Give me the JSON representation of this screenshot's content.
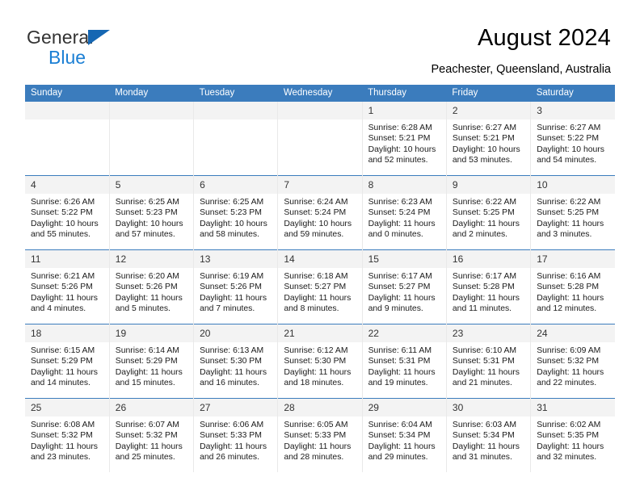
{
  "brand": {
    "name_top": "General",
    "name_bottom": "Blue",
    "accent_color": "#1567b3",
    "accent_color_text": "#1b7fd4"
  },
  "header": {
    "title": "August 2024",
    "subtitle": "Peachester, Queensland, Australia"
  },
  "theme": {
    "header_row_bg": "#3b7cbd",
    "header_row_text": "#ffffff",
    "daynum_bg": "#f3f3f3",
    "cell_bg": "#ffffff"
  },
  "weekday_headers": [
    "Sunday",
    "Monday",
    "Tuesday",
    "Wednesday",
    "Thursday",
    "Friday",
    "Saturday"
  ],
  "labels": {
    "sunrise_prefix": "Sunrise:",
    "sunset_prefix": "Sunset:",
    "daylight_prefix": "Daylight:"
  },
  "weeks": [
    [
      {
        "day": "",
        "empty": true
      },
      {
        "day": "",
        "empty": true
      },
      {
        "day": "",
        "empty": true
      },
      {
        "day": "",
        "empty": true
      },
      {
        "day": "1",
        "sunrise": "Sunrise: 6:28 AM",
        "sunset": "Sunset: 5:21 PM",
        "daylight_1": "Daylight: 10 hours",
        "daylight_2": "and 52 minutes."
      },
      {
        "day": "2",
        "sunrise": "Sunrise: 6:27 AM",
        "sunset": "Sunset: 5:21 PM",
        "daylight_1": "Daylight: 10 hours",
        "daylight_2": "and 53 minutes."
      },
      {
        "day": "3",
        "sunrise": "Sunrise: 6:27 AM",
        "sunset": "Sunset: 5:22 PM",
        "daylight_1": "Daylight: 10 hours",
        "daylight_2": "and 54 minutes."
      }
    ],
    [
      {
        "day": "4",
        "sunrise": "Sunrise: 6:26 AM",
        "sunset": "Sunset: 5:22 PM",
        "daylight_1": "Daylight: 10 hours",
        "daylight_2": "and 55 minutes."
      },
      {
        "day": "5",
        "sunrise": "Sunrise: 6:25 AM",
        "sunset": "Sunset: 5:23 PM",
        "daylight_1": "Daylight: 10 hours",
        "daylight_2": "and 57 minutes."
      },
      {
        "day": "6",
        "sunrise": "Sunrise: 6:25 AM",
        "sunset": "Sunset: 5:23 PM",
        "daylight_1": "Daylight: 10 hours",
        "daylight_2": "and 58 minutes."
      },
      {
        "day": "7",
        "sunrise": "Sunrise: 6:24 AM",
        "sunset": "Sunset: 5:24 PM",
        "daylight_1": "Daylight: 10 hours",
        "daylight_2": "and 59 minutes."
      },
      {
        "day": "8",
        "sunrise": "Sunrise: 6:23 AM",
        "sunset": "Sunset: 5:24 PM",
        "daylight_1": "Daylight: 11 hours",
        "daylight_2": "and 0 minutes."
      },
      {
        "day": "9",
        "sunrise": "Sunrise: 6:22 AM",
        "sunset": "Sunset: 5:25 PM",
        "daylight_1": "Daylight: 11 hours",
        "daylight_2": "and 2 minutes."
      },
      {
        "day": "10",
        "sunrise": "Sunrise: 6:22 AM",
        "sunset": "Sunset: 5:25 PM",
        "daylight_1": "Daylight: 11 hours",
        "daylight_2": "and 3 minutes."
      }
    ],
    [
      {
        "day": "11",
        "sunrise": "Sunrise: 6:21 AM",
        "sunset": "Sunset: 5:26 PM",
        "daylight_1": "Daylight: 11 hours",
        "daylight_2": "and 4 minutes."
      },
      {
        "day": "12",
        "sunrise": "Sunrise: 6:20 AM",
        "sunset": "Sunset: 5:26 PM",
        "daylight_1": "Daylight: 11 hours",
        "daylight_2": "and 5 minutes."
      },
      {
        "day": "13",
        "sunrise": "Sunrise: 6:19 AM",
        "sunset": "Sunset: 5:26 PM",
        "daylight_1": "Daylight: 11 hours",
        "daylight_2": "and 7 minutes."
      },
      {
        "day": "14",
        "sunrise": "Sunrise: 6:18 AM",
        "sunset": "Sunset: 5:27 PM",
        "daylight_1": "Daylight: 11 hours",
        "daylight_2": "and 8 minutes."
      },
      {
        "day": "15",
        "sunrise": "Sunrise: 6:17 AM",
        "sunset": "Sunset: 5:27 PM",
        "daylight_1": "Daylight: 11 hours",
        "daylight_2": "and 9 minutes."
      },
      {
        "day": "16",
        "sunrise": "Sunrise: 6:17 AM",
        "sunset": "Sunset: 5:28 PM",
        "daylight_1": "Daylight: 11 hours",
        "daylight_2": "and 11 minutes."
      },
      {
        "day": "17",
        "sunrise": "Sunrise: 6:16 AM",
        "sunset": "Sunset: 5:28 PM",
        "daylight_1": "Daylight: 11 hours",
        "daylight_2": "and 12 minutes."
      }
    ],
    [
      {
        "day": "18",
        "sunrise": "Sunrise: 6:15 AM",
        "sunset": "Sunset: 5:29 PM",
        "daylight_1": "Daylight: 11 hours",
        "daylight_2": "and 14 minutes."
      },
      {
        "day": "19",
        "sunrise": "Sunrise: 6:14 AM",
        "sunset": "Sunset: 5:29 PM",
        "daylight_1": "Daylight: 11 hours",
        "daylight_2": "and 15 minutes."
      },
      {
        "day": "20",
        "sunrise": "Sunrise: 6:13 AM",
        "sunset": "Sunset: 5:30 PM",
        "daylight_1": "Daylight: 11 hours",
        "daylight_2": "and 16 minutes."
      },
      {
        "day": "21",
        "sunrise": "Sunrise: 6:12 AM",
        "sunset": "Sunset: 5:30 PM",
        "daylight_1": "Daylight: 11 hours",
        "daylight_2": "and 18 minutes."
      },
      {
        "day": "22",
        "sunrise": "Sunrise: 6:11 AM",
        "sunset": "Sunset: 5:31 PM",
        "daylight_1": "Daylight: 11 hours",
        "daylight_2": "and 19 minutes."
      },
      {
        "day": "23",
        "sunrise": "Sunrise: 6:10 AM",
        "sunset": "Sunset: 5:31 PM",
        "daylight_1": "Daylight: 11 hours",
        "daylight_2": "and 21 minutes."
      },
      {
        "day": "24",
        "sunrise": "Sunrise: 6:09 AM",
        "sunset": "Sunset: 5:32 PM",
        "daylight_1": "Daylight: 11 hours",
        "daylight_2": "and 22 minutes."
      }
    ],
    [
      {
        "day": "25",
        "sunrise": "Sunrise: 6:08 AM",
        "sunset": "Sunset: 5:32 PM",
        "daylight_1": "Daylight: 11 hours",
        "daylight_2": "and 23 minutes."
      },
      {
        "day": "26",
        "sunrise": "Sunrise: 6:07 AM",
        "sunset": "Sunset: 5:32 PM",
        "daylight_1": "Daylight: 11 hours",
        "daylight_2": "and 25 minutes."
      },
      {
        "day": "27",
        "sunrise": "Sunrise: 6:06 AM",
        "sunset": "Sunset: 5:33 PM",
        "daylight_1": "Daylight: 11 hours",
        "daylight_2": "and 26 minutes."
      },
      {
        "day": "28",
        "sunrise": "Sunrise: 6:05 AM",
        "sunset": "Sunset: 5:33 PM",
        "daylight_1": "Daylight: 11 hours",
        "daylight_2": "and 28 minutes."
      },
      {
        "day": "29",
        "sunrise": "Sunrise: 6:04 AM",
        "sunset": "Sunset: 5:34 PM",
        "daylight_1": "Daylight: 11 hours",
        "daylight_2": "and 29 minutes."
      },
      {
        "day": "30",
        "sunrise": "Sunrise: 6:03 AM",
        "sunset": "Sunset: 5:34 PM",
        "daylight_1": "Daylight: 11 hours",
        "daylight_2": "and 31 minutes."
      },
      {
        "day": "31",
        "sunrise": "Sunrise: 6:02 AM",
        "sunset": "Sunset: 5:35 PM",
        "daylight_1": "Daylight: 11 hours",
        "daylight_2": "and 32 minutes."
      }
    ]
  ]
}
